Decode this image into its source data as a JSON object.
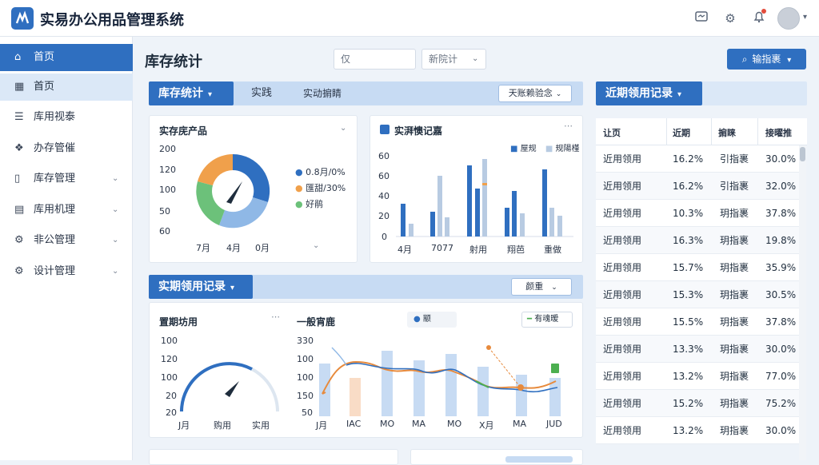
{
  "app": {
    "title": "实易办公用品管理系统"
  },
  "header_icons": [
    "message-icon",
    "gear-icon",
    "bell-icon",
    "avatar"
  ],
  "sidebar": {
    "items": [
      {
        "label": "首页",
        "icon": "home-icon",
        "state": "active"
      },
      {
        "label": "首页",
        "icon": "grid-icon",
        "state": "selected"
      },
      {
        "label": "库用视泰",
        "icon": "list-icon"
      },
      {
        "label": "办存管催",
        "icon": "box-icon"
      },
      {
        "label": "库存管理",
        "icon": "bookmark-icon",
        "chevron": true
      },
      {
        "label": "库用机理",
        "icon": "document-icon",
        "chevron": true
      },
      {
        "label": "非公管理",
        "icon": "gear-icon",
        "chevron": true
      },
      {
        "label": "设计管理",
        "icon": "gear-icon",
        "chevron": true
      }
    ]
  },
  "page": {
    "title": "库存统计",
    "search_value": "仅",
    "filter_value": "新院计",
    "primary_button": "输指裹"
  },
  "strip1": {
    "active": "库存统计",
    "tabs": [
      "实践",
      "实动掮睛"
    ],
    "button": "天账赖验念"
  },
  "strip2": {
    "active": "实期领用记录",
    "button": "颜重"
  },
  "right_panel": {
    "title": "近期领用记录",
    "columns": [
      "让页",
      "近期",
      "掮睐",
      "接曜推"
    ],
    "rows": [
      [
        "近用领用",
        "16.2%",
        "引指裹",
        "30.0%"
      ],
      [
        "近用领用",
        "16.2%",
        "引指裹",
        "32.0%"
      ],
      [
        "近用领用",
        "10.3%",
        "玥指裹",
        "37.8%"
      ],
      [
        "近用领用",
        "16.3%",
        "玥指裹",
        "19.8%"
      ],
      [
        "近用领用",
        "15.7%",
        "玥指裹",
        "35.9%"
      ],
      [
        "近用领用",
        "15.3%",
        "玥指裹",
        "30.5%"
      ],
      [
        "近用领用",
        "15.5%",
        "玥指裹",
        "37.8%"
      ],
      [
        "近用领用",
        "13.3%",
        "玥指裹",
        "30.0%"
      ],
      [
        "近用领用",
        "13.2%",
        "玥指裹",
        "77.0%"
      ],
      [
        "近用领用",
        "15.2%",
        "玥指裹",
        "75.2%"
      ],
      [
        "近用领用",
        "13.2%",
        "玥指裹",
        "30.0%"
      ]
    ]
  },
  "card_donut": {
    "title": "实存庑产品",
    "yticks": [
      "200",
      "120",
      "100",
      "50",
      "60"
    ],
    "xticks": [
      "7月",
      "4月",
      "0月"
    ],
    "legend": [
      "0.8月/0%",
      "匯甜/30%",
      "好鹃"
    ],
    "colors": [
      "#2f6fc0",
      "#f0a04b",
      "#6cc17a",
      "#8fb8e6"
    ]
  },
  "card_bars": {
    "title": "实湃懊记嘉",
    "legend": [
      "屋规",
      "规陽槿"
    ],
    "yticks": [
      "60",
      "60",
      "40",
      "20",
      "0"
    ],
    "xticks": [
      "4月",
      "7077",
      "射用",
      "翔芭",
      "重做"
    ]
  },
  "card_gauge": {
    "title": "置期坊用",
    "yticks": [
      "100",
      "120",
      "100",
      "20",
      "20"
    ],
    "xticks": [
      "J月",
      "购用",
      "实用"
    ]
  },
  "card_combo": {
    "title": "一般宵鹿",
    "legend_center": "颛",
    "legend_right": "有魂暧",
    "yticks": [
      "330",
      "100",
      "100",
      "150",
      "50"
    ],
    "xticks": [
      "J月",
      "IAC",
      "MO",
      "MA",
      "MO",
      "X月",
      "MA",
      "JUD"
    ]
  }
}
